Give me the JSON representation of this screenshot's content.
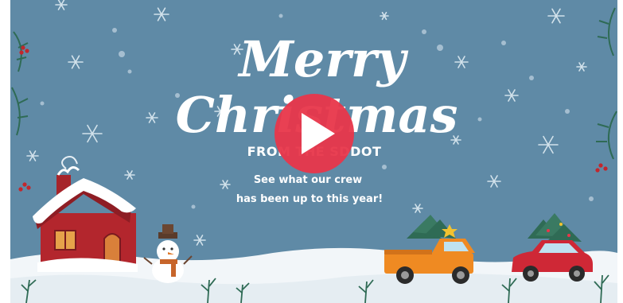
{
  "video": {
    "title_line1": "Merry",
    "title_line2": "Christmas",
    "from_line": "FROM THE SDDOT",
    "caption_line1": "See what our crew",
    "caption_line2": "has been up to this year!"
  },
  "colors": {
    "background": "#5f8aa6",
    "play_button": "#e8364a",
    "snow": "#ffffff"
  },
  "icons": {
    "play": "play-icon"
  }
}
